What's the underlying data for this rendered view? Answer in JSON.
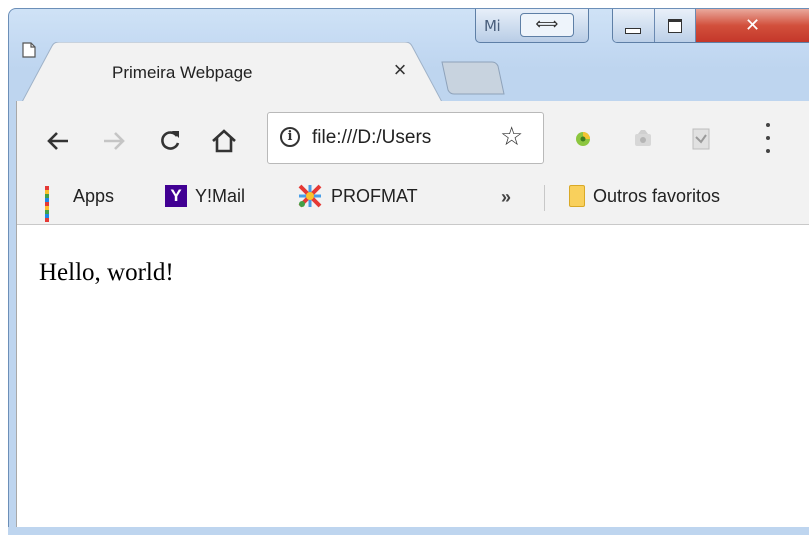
{
  "caption": {
    "partial_icon_label": "Mi",
    "arrow_glyph": "⟺"
  },
  "tab": {
    "title": "Primeira Webpage",
    "close_glyph": "×"
  },
  "toolbar": {
    "back_icon": "back-arrow-icon",
    "forward_icon": "forward-arrow-icon",
    "reload_icon": "reload-icon",
    "home_icon": "home-icon",
    "omnibox": {
      "url": "file:///D:/Users",
      "info_glyph": "i",
      "star_glyph": "☆"
    },
    "extensions": [
      "ext-colorful-icon",
      "ext-gray-icon",
      "ext-doc-icon"
    ],
    "menu_icon": "more-vert-icon"
  },
  "bookmarks": {
    "items": [
      {
        "label": "Apps",
        "icon": "apps-grid-icon"
      },
      {
        "label": "Y!Mail",
        "icon": "yahoo-mail-icon",
        "glyph": "Y"
      },
      {
        "label": "PROFMAT",
        "icon": "profmat-icon"
      }
    ],
    "overflow_glyph": "»",
    "other_bookmarks": "Outros favoritos"
  },
  "page": {
    "body_text": "Hello, world!"
  },
  "colors": {
    "title_bar": "#bed5ef",
    "close_button": "#d2503c",
    "toolbar_bg": "#f2f2f2",
    "yahoo_purple": "#410093",
    "folder_yellow": "#f9d05c"
  }
}
